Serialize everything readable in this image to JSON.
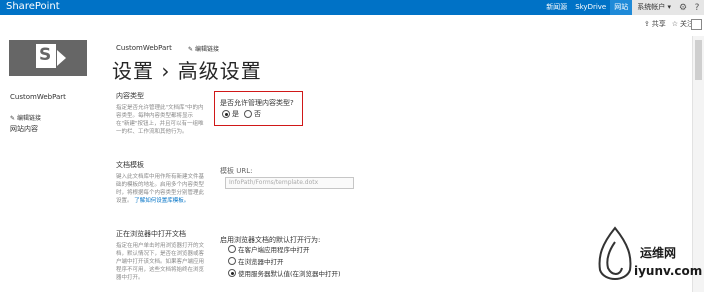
{
  "topbar": {
    "brand": "SharePoint",
    "links": [
      "新闻源",
      "SkyDrive",
      "网站"
    ],
    "user": "系统帐户 ▾"
  },
  "subbar": {
    "share": "共享",
    "follow": "关注"
  },
  "header": {
    "site_title": "CustomWebPart",
    "edit_links": "编辑链接",
    "page_title": "设置 › 高级设置"
  },
  "leftnav": {
    "site": "CustomWebPart",
    "edit_links": "编辑链接",
    "site_content": "网站内容"
  },
  "sections": [
    {
      "title": "内容类型",
      "desc": "指定是否允许管理此\"文档库\"中的内容类型。每种内容类型都将显示在\"新建\"按钮上，并且可以有一组唯一的栏、工作流和其他行为。"
    },
    {
      "title": "文档模板",
      "desc": "键入此文档库中用作所有新建文件基础的模板的地址。启用多个内容类型时，将根据每个内容类型分别管理此设置。",
      "link": "了解如何设置库模板。"
    },
    {
      "title": "正在浏览器中打开文档",
      "desc": "指定在用户单击时用浏览器打开的文档，默认情况下，是否在浏览器或客户端中打开该文档。如果客户端应用程序不可用，这些文档将始终在浏览器中打开。"
    }
  ],
  "content_types": {
    "question": "是否允许管理内容类型?",
    "yes": "是",
    "no": "否",
    "selected": "yes"
  },
  "template": {
    "label": "模板 URL:",
    "value": "InfoPath/Forms/template.dotx"
  },
  "browser_open": {
    "label": "启用浏览器文档的默认打开行为:",
    "options": [
      "在客户端应用程序中打开",
      "在浏览器中打开",
      "使用服务器默认值(在浏览器中打开)"
    ],
    "selected_index": 2
  },
  "watermark": {
    "line1": "运维网",
    "line2": "iyunv.com"
  },
  "colors": {
    "topbar": "#0072c6",
    "highlight_box": "#d01818"
  }
}
